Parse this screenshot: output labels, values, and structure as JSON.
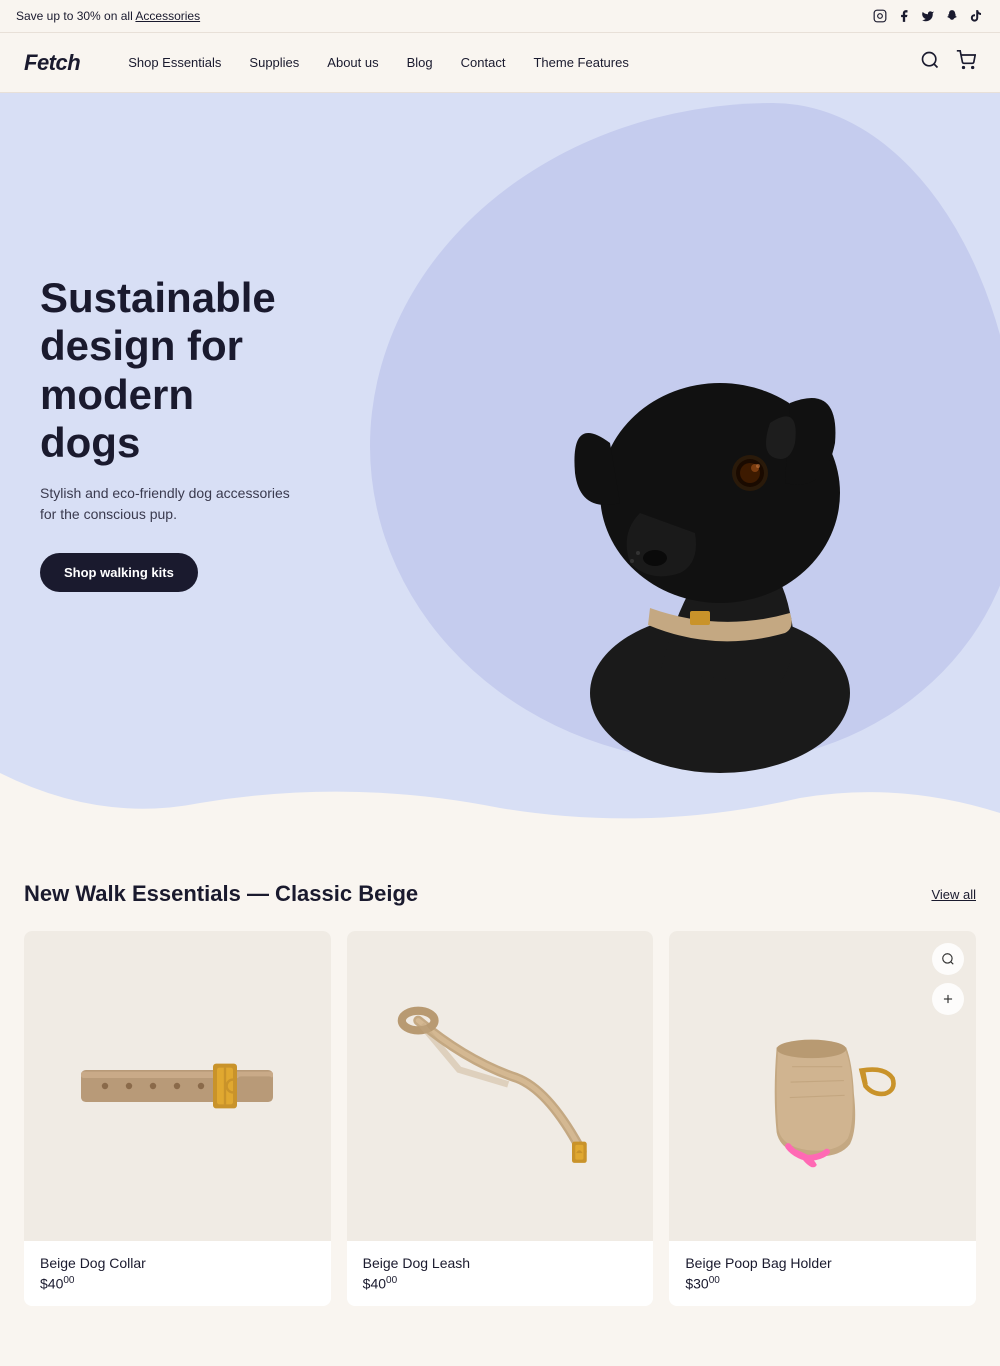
{
  "announcement": {
    "text": "Save up to 30% on all ",
    "link_text": "Accessories"
  },
  "social_icons": [
    {
      "name": "instagram",
      "symbol": "📷"
    },
    {
      "name": "facebook",
      "symbol": "f"
    },
    {
      "name": "twitter",
      "symbol": "𝕏"
    },
    {
      "name": "snapchat",
      "symbol": "👻"
    },
    {
      "name": "tiktok",
      "symbol": "♪"
    }
  ],
  "header": {
    "logo": "Fetch",
    "nav": [
      {
        "label": "Shop Essentials",
        "href": "#"
      },
      {
        "label": "Supplies",
        "href": "#"
      },
      {
        "label": "About us",
        "href": "#"
      },
      {
        "label": "Blog",
        "href": "#"
      },
      {
        "label": "Contact",
        "href": "#"
      },
      {
        "label": "Theme Features",
        "href": "#"
      }
    ],
    "search_icon": "🔍",
    "cart_icon": "🛒"
  },
  "hero": {
    "title": "Sustainable design for modern dogs",
    "subtitle": "Stylish and eco-friendly dog accessories for the conscious pup.",
    "cta_label": "Shop walking kits",
    "bg_color": "#d8dff5"
  },
  "products_section": {
    "title": "New Walk Essentials — Classic Beige",
    "view_all_label": "View all",
    "products": [
      {
        "name": "Beige Dog Collar",
        "price_main": "$40",
        "price_cents": "00",
        "image_alt": "Beige Dog Collar"
      },
      {
        "name": "Beige Dog Leash",
        "price_main": "$40",
        "price_cents": "00",
        "image_alt": "Beige Dog Leash"
      },
      {
        "name": "Beige Poop Bag Holder",
        "price_main": "$30",
        "price_cents": "00",
        "image_alt": "Beige Poop Bag Holder"
      }
    ]
  }
}
